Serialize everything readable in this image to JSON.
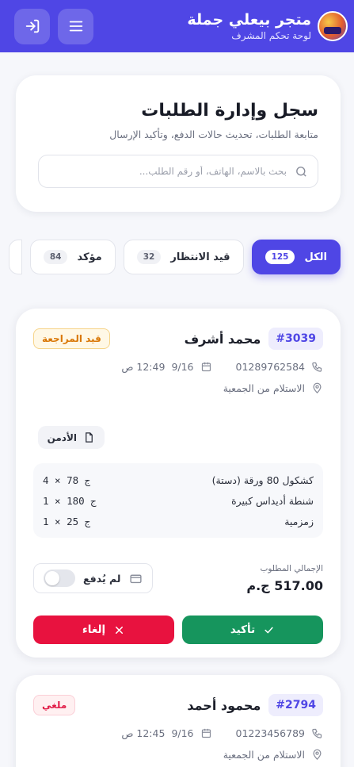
{
  "header": {
    "title": "متجر بيعلي جملة",
    "subtitle": "لوحة تحكم المشرف",
    "menu_icon": "menu-icon",
    "logout_icon": "logout-icon",
    "brand_color": "#4f46e5"
  },
  "page": {
    "title": "سجل وإدارة الطلبات",
    "subtitle": "متابعة الطلبات، تحديث حالات الدفع، وتأكيد الإرسال",
    "search_placeholder": "بحث بالاسم، الهاتف، أو رقم الطلب..."
  },
  "tabs": [
    {
      "label": "الكل",
      "count": "125",
      "active": true
    },
    {
      "label": "قيد الانتظار",
      "count": "32",
      "active": false
    },
    {
      "label": "مؤكد",
      "count": "84",
      "active": false
    }
  ],
  "orders": [
    {
      "id": "#3039",
      "customer": "محمد أشرف",
      "status": "قيد المراجعة",
      "phone": "01289762584",
      "date": "9/16",
      "time": "12:49 ص",
      "delivery": "الاستلام من الجمعية",
      "created_by": "الأدمن",
      "items": [
        {
          "name": "كشكول 80 ورقة (دستة)",
          "qty": "4 × 78 ج"
        },
        {
          "name": "شنطة أديداس كبيرة",
          "qty": "1 × 180 ج"
        },
        {
          "name": "زمزمية",
          "qty": "1 × 25 ج"
        }
      ],
      "total_label": "الإجمالي المطلوب",
      "total": "517.00 ج.م",
      "payment_label": "لم يُدفع",
      "confirm_label": "تأكيد",
      "cancel_label": "إلغاء"
    },
    {
      "id": "#2794",
      "customer": "محمود أحمد",
      "status": "ملغي",
      "phone": "01223456789",
      "date": "9/16",
      "time": "12:45 ص",
      "delivery": "الاستلام من الجمعية"
    }
  ]
}
